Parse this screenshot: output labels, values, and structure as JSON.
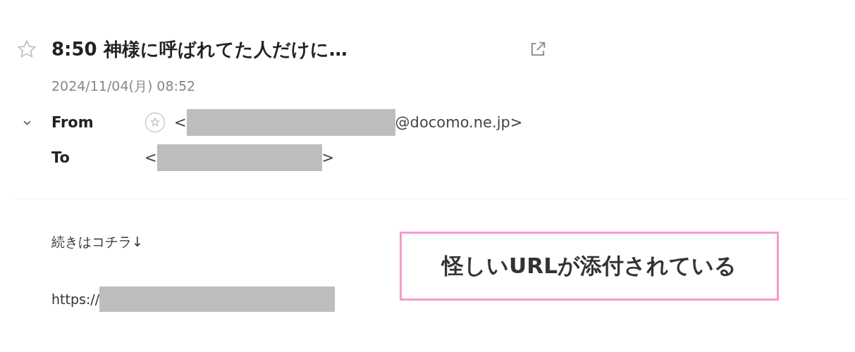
{
  "message": {
    "starred": false,
    "subject": "8:50 神様に呼ばれてた人だけに…",
    "date": "2024/11/04(月) 08:52",
    "from": {
      "label": "From",
      "open": "<",
      "domain": "@docomo.ne.jp>"
    },
    "to": {
      "label": "To",
      "open": "<",
      "close": ">"
    },
    "body": {
      "line": "続きはコチラ↓",
      "link_prefix": "https://"
    }
  },
  "callout": {
    "text": "怪しいURLが添付されている"
  }
}
